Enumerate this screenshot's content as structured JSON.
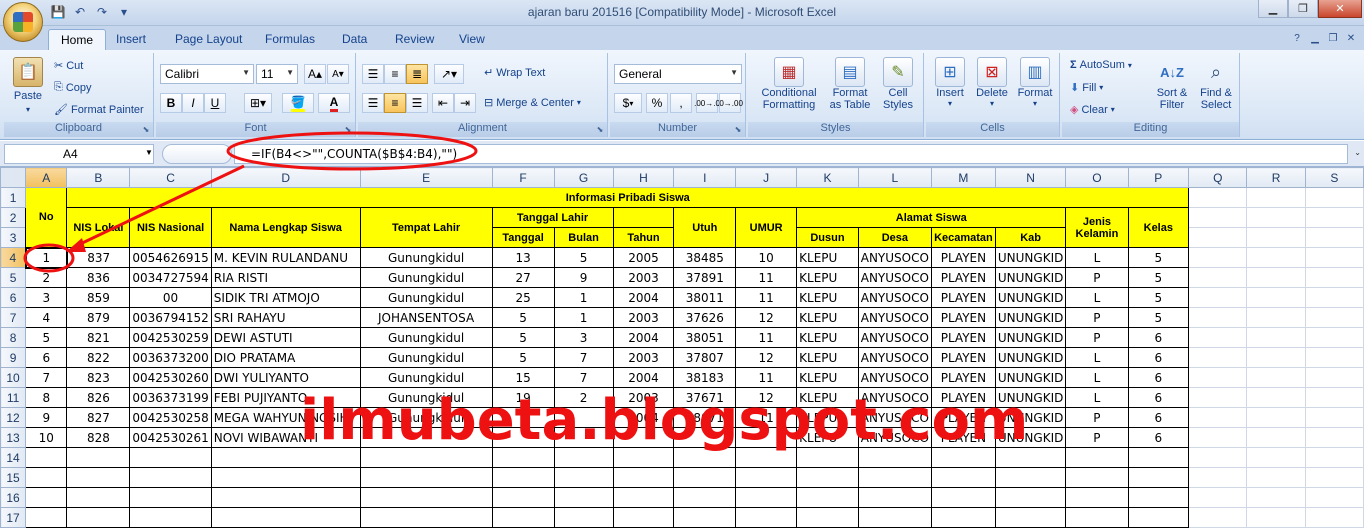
{
  "window": {
    "title": "ajaran baru 201516  [Compatibility Mode] - Microsoft Excel",
    "minimize": "▁",
    "restore": "❐",
    "close": "✕"
  },
  "tabs": [
    "Home",
    "Insert",
    "Page Layout",
    "Formulas",
    "Data",
    "Review",
    "View"
  ],
  "ribbon": {
    "clipboard": {
      "label": "Clipboard",
      "paste": "Paste",
      "cut": "Cut",
      "copy": "Copy",
      "format_painter": "Format Painter"
    },
    "font": {
      "label": "Font",
      "font_name": "Calibri",
      "font_size": "11",
      "bold": "B",
      "italic": "I",
      "underline": "U"
    },
    "alignment": {
      "label": "Alignment",
      "wrap_text": "Wrap Text",
      "merge_center": "Merge & Center"
    },
    "number": {
      "label": "Number",
      "format": "General",
      "currency": "$",
      "percent": "%",
      "comma": ",",
      "inc_dec": ".00→.0",
      "dec_dec": ".0→.00"
    },
    "styles": {
      "label": "Styles",
      "conditional_1": "Conditional",
      "conditional_2": "Formatting",
      "format_table_1": "Format",
      "format_table_2": "as Table",
      "cell_styles_1": "Cell",
      "cell_styles_2": "Styles"
    },
    "cells": {
      "label": "Cells",
      "insert": "Insert",
      "delete": "Delete",
      "format": "Format"
    },
    "editing": {
      "label": "Editing",
      "autosum": "AutoSum",
      "fill": "Fill",
      "clear": "Clear",
      "sort_1": "Sort &",
      "sort_2": "Filter",
      "find_1": "Find &",
      "find_2": "Select"
    }
  },
  "formula_bar": {
    "name_box": "A4",
    "formula": "=IF(B4<>\"\",COUNTA($B$4:B4),\"\")"
  },
  "columns": [
    "A",
    "B",
    "C",
    "D",
    "E",
    "F",
    "G",
    "H",
    "I",
    "J",
    "K",
    "L",
    "M",
    "N",
    "O",
    "P",
    "Q",
    "R",
    "S"
  ],
  "headers": {
    "no": "No",
    "info": "Informasi Pribadi Siswa",
    "nis_lokal": "NIS Lokal",
    "nis_nasional": "NIS Nasional",
    "nama": "Nama Lengkap Siswa",
    "tempat": "Tempat Lahir",
    "tanggal_lahir": "Tanggal Lahir",
    "tanggal": "Tanggal",
    "bulan": "Bulan",
    "tahun": "Tahun",
    "utuh": "Utuh",
    "umur": "UMUR",
    "alamat": "Alamat Siswa",
    "dusun": "Dusun",
    "desa": "Desa",
    "kecamatan": "Kecamatan",
    "kab": "Kab",
    "jenis_1": "Jenis",
    "jenis_2": "Kelamin",
    "kelas": "Kelas"
  },
  "rows": [
    [
      "1",
      "837",
      "0054626915",
      "M. KEVIN RULANDANU",
      "Gunungkidul",
      "13",
      "5",
      "2005",
      "38485",
      "10",
      "KLEPU",
      "ANYUSOCO",
      "PLAYEN",
      "UNUNGKID",
      "L",
      "5"
    ],
    [
      "2",
      "836",
      "0034727594",
      "RIA RISTI",
      "Gunungkidul",
      "27",
      "9",
      "2003",
      "37891",
      "11",
      "KLEPU",
      "ANYUSOCO",
      "PLAYEN",
      "UNUNGKID",
      "P",
      "5"
    ],
    [
      "3",
      "859",
      "00",
      "SIDIK TRI ATMOJO",
      "Gunungkidul",
      "25",
      "1",
      "2004",
      "38011",
      "11",
      "KLEPU",
      "ANYUSOCO",
      "PLAYEN",
      "UNUNGKID",
      "L",
      "5"
    ],
    [
      "4",
      "879",
      "0036794152",
      "SRI RAHAYU",
      "JOHANSENTOSA",
      "5",
      "1",
      "2003",
      "37626",
      "12",
      "KLEPU",
      "ANYUSOCO",
      "PLAYEN",
      "UNUNGKID",
      "P",
      "5"
    ],
    [
      "5",
      "821",
      "0042530259",
      "DEWI ASTUTI",
      "Gunungkidul",
      "5",
      "3",
      "2004",
      "38051",
      "11",
      "KLEPU",
      "ANYUSOCO",
      "PLAYEN",
      "UNUNGKID",
      "P",
      "6"
    ],
    [
      "6",
      "822",
      "0036373200",
      "DIO PRATAMA",
      "Gunungkidul",
      "5",
      "7",
      "2003",
      "37807",
      "12",
      "KLEPU",
      "ANYUSOCO",
      "PLAYEN",
      "UNUNGKID",
      "L",
      "6"
    ],
    [
      "7",
      "823",
      "0042530260",
      "DWI YULIYANTO",
      "Gunungkidul",
      "15",
      "7",
      "2004",
      "38183",
      "11",
      "KLEPU",
      "ANYUSOCO",
      "PLAYEN",
      "UNUNGKID",
      "L",
      "6"
    ],
    [
      "8",
      "826",
      "0036373199",
      "FEBI PUJIYANTO",
      "Gunungkidul",
      "19",
      "2",
      "2003",
      "37671",
      "12",
      "KLEPU",
      "ANYUSOCO",
      "PLAYEN",
      "UNUNGKID",
      "L",
      "6"
    ],
    [
      "9",
      "827",
      "0042530258",
      "MEGA WAHYUNINGSIH",
      "Gunungkidul",
      "",
      "",
      "2004",
      "38071",
      "11",
      "KLEPU",
      "ANYUSOCO",
      "PLAYEN",
      "UNUNGKID",
      "P",
      "6"
    ],
    [
      "10",
      "828",
      "0042530261",
      "NOVI WIBAWANTI",
      "",
      "",
      "",
      "",
      "",
      "",
      "KLEPU",
      "ANYUSOCO",
      "PLAYEN",
      "UNUNGKID",
      "P",
      "6"
    ]
  ],
  "row_numbers": [
    "1",
    "2",
    "3",
    "4",
    "5",
    "6",
    "7",
    "8",
    "9",
    "10",
    "11",
    "12",
    "13",
    "14",
    "15",
    "16",
    "17"
  ],
  "watermark": "ilmubeta.blogspot.com",
  "colors": {
    "highlight": "#ffff00",
    "annotation": "#ee1111"
  }
}
